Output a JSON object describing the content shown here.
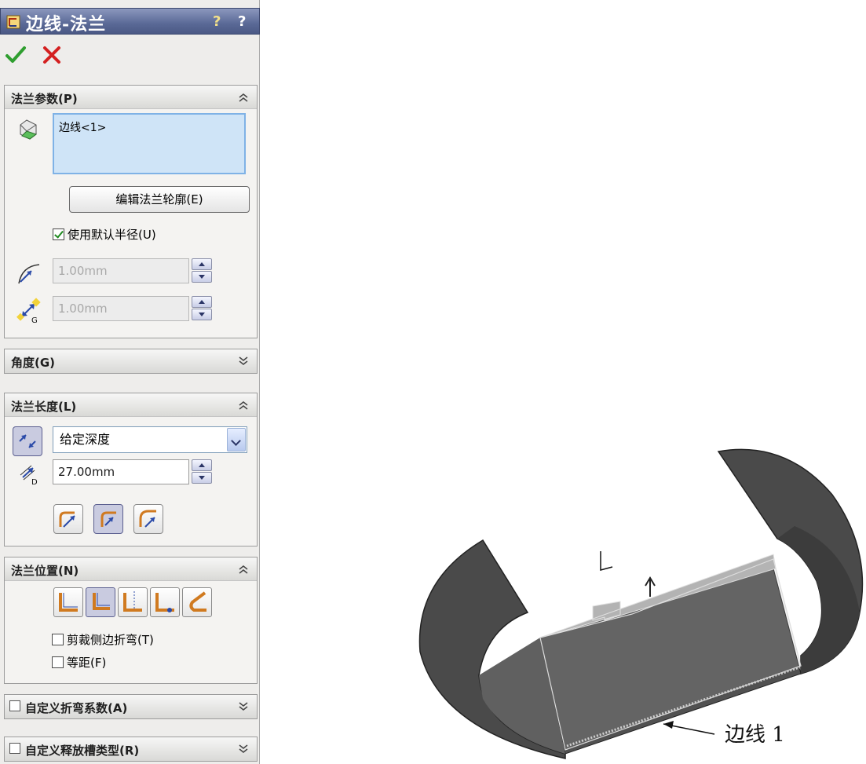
{
  "panel": {
    "title": "边线-法兰",
    "help_labels": [
      "?",
      "?"
    ],
    "ok_icon": "check-icon",
    "cancel_icon": "x-icon"
  },
  "flange_params": {
    "header": "法兰参数(P)",
    "edge_list": [
      "边线<1>"
    ],
    "edit_profile_button": "编辑法兰轮廓(E)",
    "use_default_radius": {
      "label": "使用默认半径(U)",
      "checked": true
    },
    "radius": {
      "value": "1.00mm",
      "enabled": false
    },
    "gap": {
      "value": "1.00mm",
      "enabled": false
    }
  },
  "angle": {
    "header": "角度(G)",
    "expanded": false
  },
  "flange_length": {
    "header": "法兰长度(L)",
    "end_condition": "给定深度",
    "length": "27.00mm",
    "buttons": [
      "outer-virtual-sharp-icon",
      "inner-virtual-sharp-icon",
      "tangent-bend-icon"
    ],
    "active_button": 1
  },
  "flange_position": {
    "header": "法兰位置(N)",
    "buttons": [
      "material-inside-icon",
      "material-outside-icon",
      "bend-outside-icon",
      "bend-from-virtual-sharp-icon",
      "tangent-to-bend-icon"
    ],
    "active_button": 1,
    "trim_side_bends": {
      "label": "剪裁侧边折弯(T)",
      "checked": false
    },
    "offset": {
      "label": "等距(F)",
      "checked": false
    }
  },
  "custom_bend_allowance": {
    "header": "自定义折弯系数(A)",
    "checked": false,
    "expanded": false
  },
  "custom_relief_type": {
    "header": "自定义释放槽类型(R)",
    "checked": false,
    "expanded": false
  },
  "model": {
    "edge_callout": "边线 1"
  },
  "colors": {
    "titlebar": "#5a6996",
    "model_dark": "#4a4a4a",
    "model_shade": "#6a6a6a",
    "flange_preview": "#b3b3b3"
  }
}
